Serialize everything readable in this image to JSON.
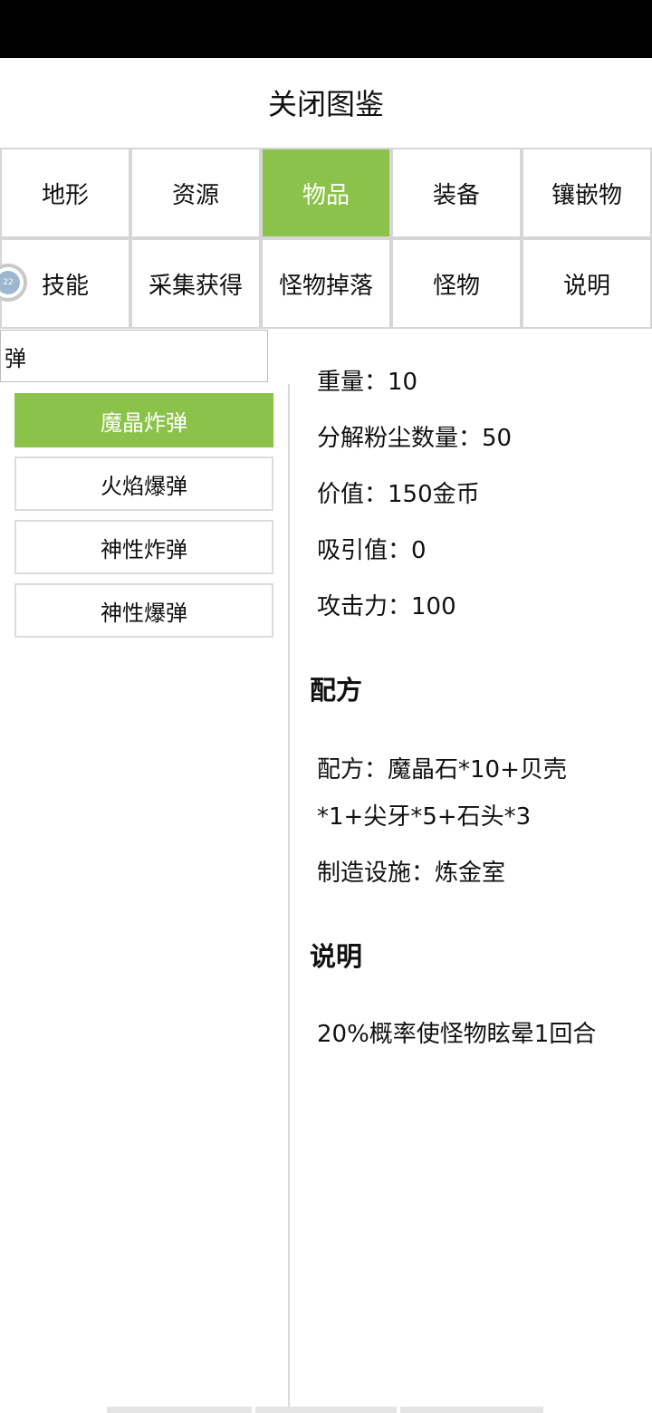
{
  "header": {
    "title": "关闭图鉴"
  },
  "tabs": {
    "row1": [
      "地形",
      "资源",
      "物品",
      "装备",
      "镶嵌物"
    ],
    "row2": [
      "技能",
      "采集获得",
      "怪物掉落",
      "怪物",
      "说明"
    ],
    "active": "物品"
  },
  "avatar": {
    "text": "22"
  },
  "search": {
    "value": "弹"
  },
  "items": [
    "魔晶炸弹",
    "火焰爆弹",
    "神性炸弹",
    "神性爆弹"
  ],
  "selected_item": "魔晶炸弹",
  "details": {
    "weight": "重量：10",
    "dust": "分解粉尘数量：50",
    "value": "价值：150金币",
    "attract": "吸引值：0",
    "attack": "攻击力：100"
  },
  "recipe": {
    "heading": "配方",
    "line1": "配方：魔晶石*10+贝壳",
    "line2": "*1+尖牙*5+石头*3",
    "facility": "制造设施：炼金室"
  },
  "description": {
    "heading": "说明",
    "text": "20%概率使怪物眩晕1回合"
  },
  "colors": {
    "accent": "#8bc34a",
    "grid": "#d6d6d6"
  }
}
